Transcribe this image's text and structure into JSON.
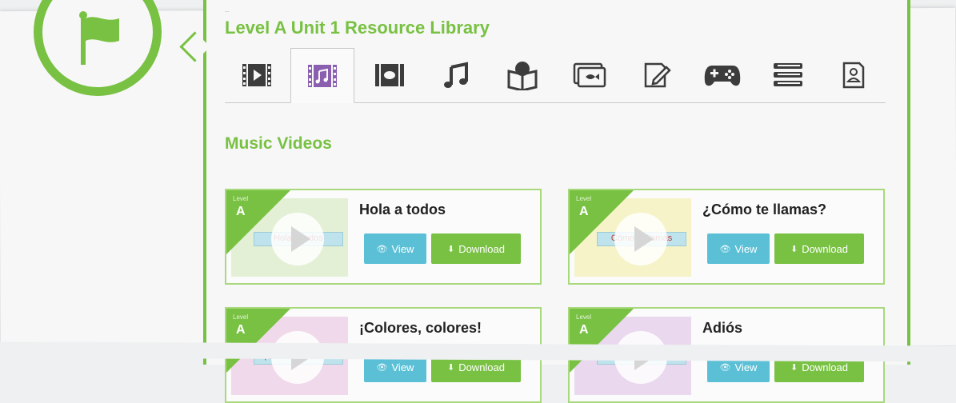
{
  "header": {
    "breadcrumb": "...",
    "title": "Level A Unit 1 Resource Library"
  },
  "tabs": [
    {
      "icon": "film-icon",
      "active": false
    },
    {
      "icon": "music-video-icon",
      "active": true
    },
    {
      "icon": "video-icon",
      "active": false
    },
    {
      "icon": "music-note-icon",
      "active": false
    },
    {
      "icon": "book-icon",
      "active": false
    },
    {
      "icon": "slideshow-icon",
      "active": false
    },
    {
      "icon": "edit-document-icon",
      "active": false
    },
    {
      "icon": "gamepad-icon",
      "active": false
    },
    {
      "icon": "stack-icon",
      "active": false
    },
    {
      "icon": "profile-card-icon",
      "active": false
    }
  ],
  "section": {
    "title": "Music Videos"
  },
  "cards": [
    {
      "level_small": "Level",
      "level_letter": "A",
      "title": "Hola a todos",
      "thumb_text": "Hola a todos",
      "view_label": "View",
      "download_label": "Download"
    },
    {
      "level_small": "Level",
      "level_letter": "A",
      "title": "¿Cómo te llamas?",
      "thumb_text": "Cómo te llamas",
      "view_label": "View",
      "download_label": "Download"
    },
    {
      "level_small": "Level",
      "level_letter": "A",
      "title": "¡Colores, colores!",
      "thumb_text": "¡Colores, colores!",
      "view_label": "View",
      "download_label": "Download"
    },
    {
      "level_small": "Level",
      "level_letter": "A",
      "title": "Adiós",
      "thumb_text": "Adiós",
      "view_label": "View",
      "download_label": "Download"
    }
  ],
  "colors": {
    "accent_green": "#78c142",
    "view_blue": "#5bc0d6",
    "active_tab_purple": "#8b5fb0",
    "icon_gray": "#3c3c3c"
  }
}
